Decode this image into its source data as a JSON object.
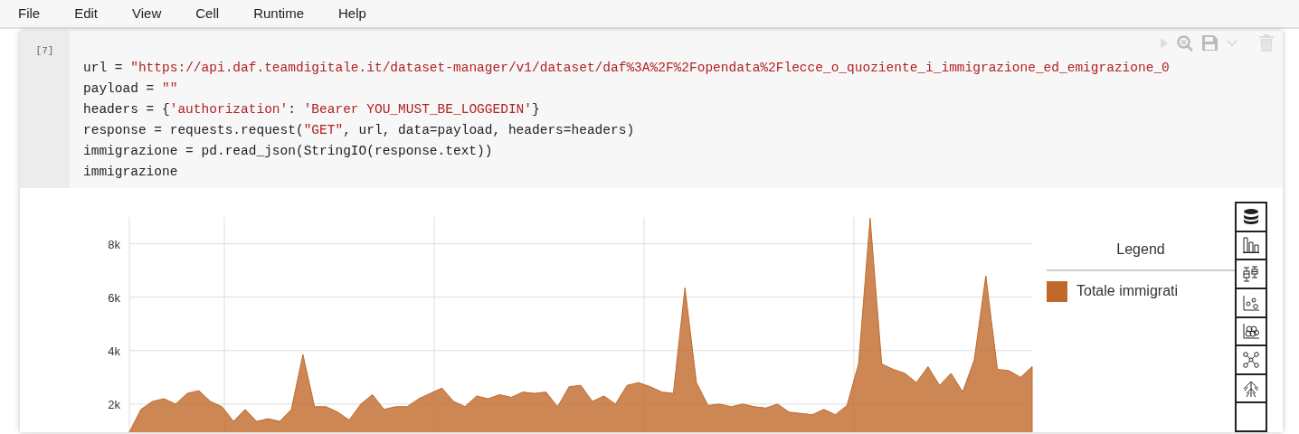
{
  "menu": [
    {
      "label": "File"
    },
    {
      "label": "Edit"
    },
    {
      "label": "View"
    },
    {
      "label": "Cell"
    },
    {
      "label": "Runtime"
    },
    {
      "label": "Help"
    }
  ],
  "cell": {
    "prompt": "[7]",
    "code_lines": [
      [
        {
          "kind": "plain",
          "text": "url = "
        },
        {
          "kind": "string",
          "text": "\"https://api.daf.teamdigitale.it/dataset-manager/v1/dataset/daf%3A%2F%2Fopendata%2Flecce_o_quoziente_i_immigrazione_ed_emigrazione_0"
        }
      ],
      [
        {
          "kind": "plain",
          "text": "payload = "
        },
        {
          "kind": "string",
          "text": "\"\""
        }
      ],
      [
        {
          "kind": "plain",
          "text": "headers = {"
        },
        {
          "kind": "string",
          "text": "'authorization'"
        },
        {
          "kind": "plain",
          "text": ": "
        },
        {
          "kind": "string",
          "text": "'Bearer YOU_MUST_BE_LOGGEDIN'"
        },
        {
          "kind": "plain",
          "text": "}"
        }
      ],
      [
        {
          "kind": "plain",
          "text": "response = requests.request("
        },
        {
          "kind": "string",
          "text": "\"GET\""
        },
        {
          "kind": "plain",
          "text": ", url, data=payload, headers=headers)"
        }
      ],
      [
        {
          "kind": "plain",
          "text": "immigrazione = pd.read_json(StringIO(response.text))"
        }
      ],
      [
        {
          "kind": "plain",
          "text": "immigrazione"
        }
      ]
    ]
  },
  "output": {
    "chart_data": {
      "type": "area",
      "grid": true,
      "ylim": [
        0,
        9000
      ],
      "yticks": [
        {
          "value": 2000,
          "label": "2k"
        },
        {
          "value": 4000,
          "label": "4k"
        },
        {
          "value": 6000,
          "label": "6k"
        },
        {
          "value": 8000,
          "label": "8k"
        }
      ],
      "series": [
        {
          "name": "Totale immigrati",
          "color": "#c0692a",
          "values": [
            950,
            1800,
            2100,
            2200,
            2000,
            2400,
            2500,
            2100,
            1900,
            1350,
            1800,
            1350,
            1450,
            1350,
            1800,
            3850,
            1900,
            1900,
            1700,
            1400,
            2000,
            2350,
            1800,
            1900,
            1900,
            2200,
            2400,
            2600,
            2100,
            1900,
            2300,
            2200,
            2350,
            2250,
            2450,
            2400,
            2450,
            1900,
            2650,
            2700,
            2100,
            2300,
            2000,
            2700,
            2800,
            2650,
            2450,
            2400,
            6350,
            2800,
            1950,
            2000,
            1900,
            2000,
            1900,
            1850,
            2000,
            1700,
            1650,
            1600,
            1800,
            1600,
            1950,
            3500,
            8950,
            3500,
            3300,
            3150,
            2800,
            3400,
            2700,
            3150,
            2450,
            3650,
            6800,
            3300,
            3250,
            3000,
            3400
          ]
        }
      ]
    },
    "legend": {
      "title": "Legend"
    }
  }
}
